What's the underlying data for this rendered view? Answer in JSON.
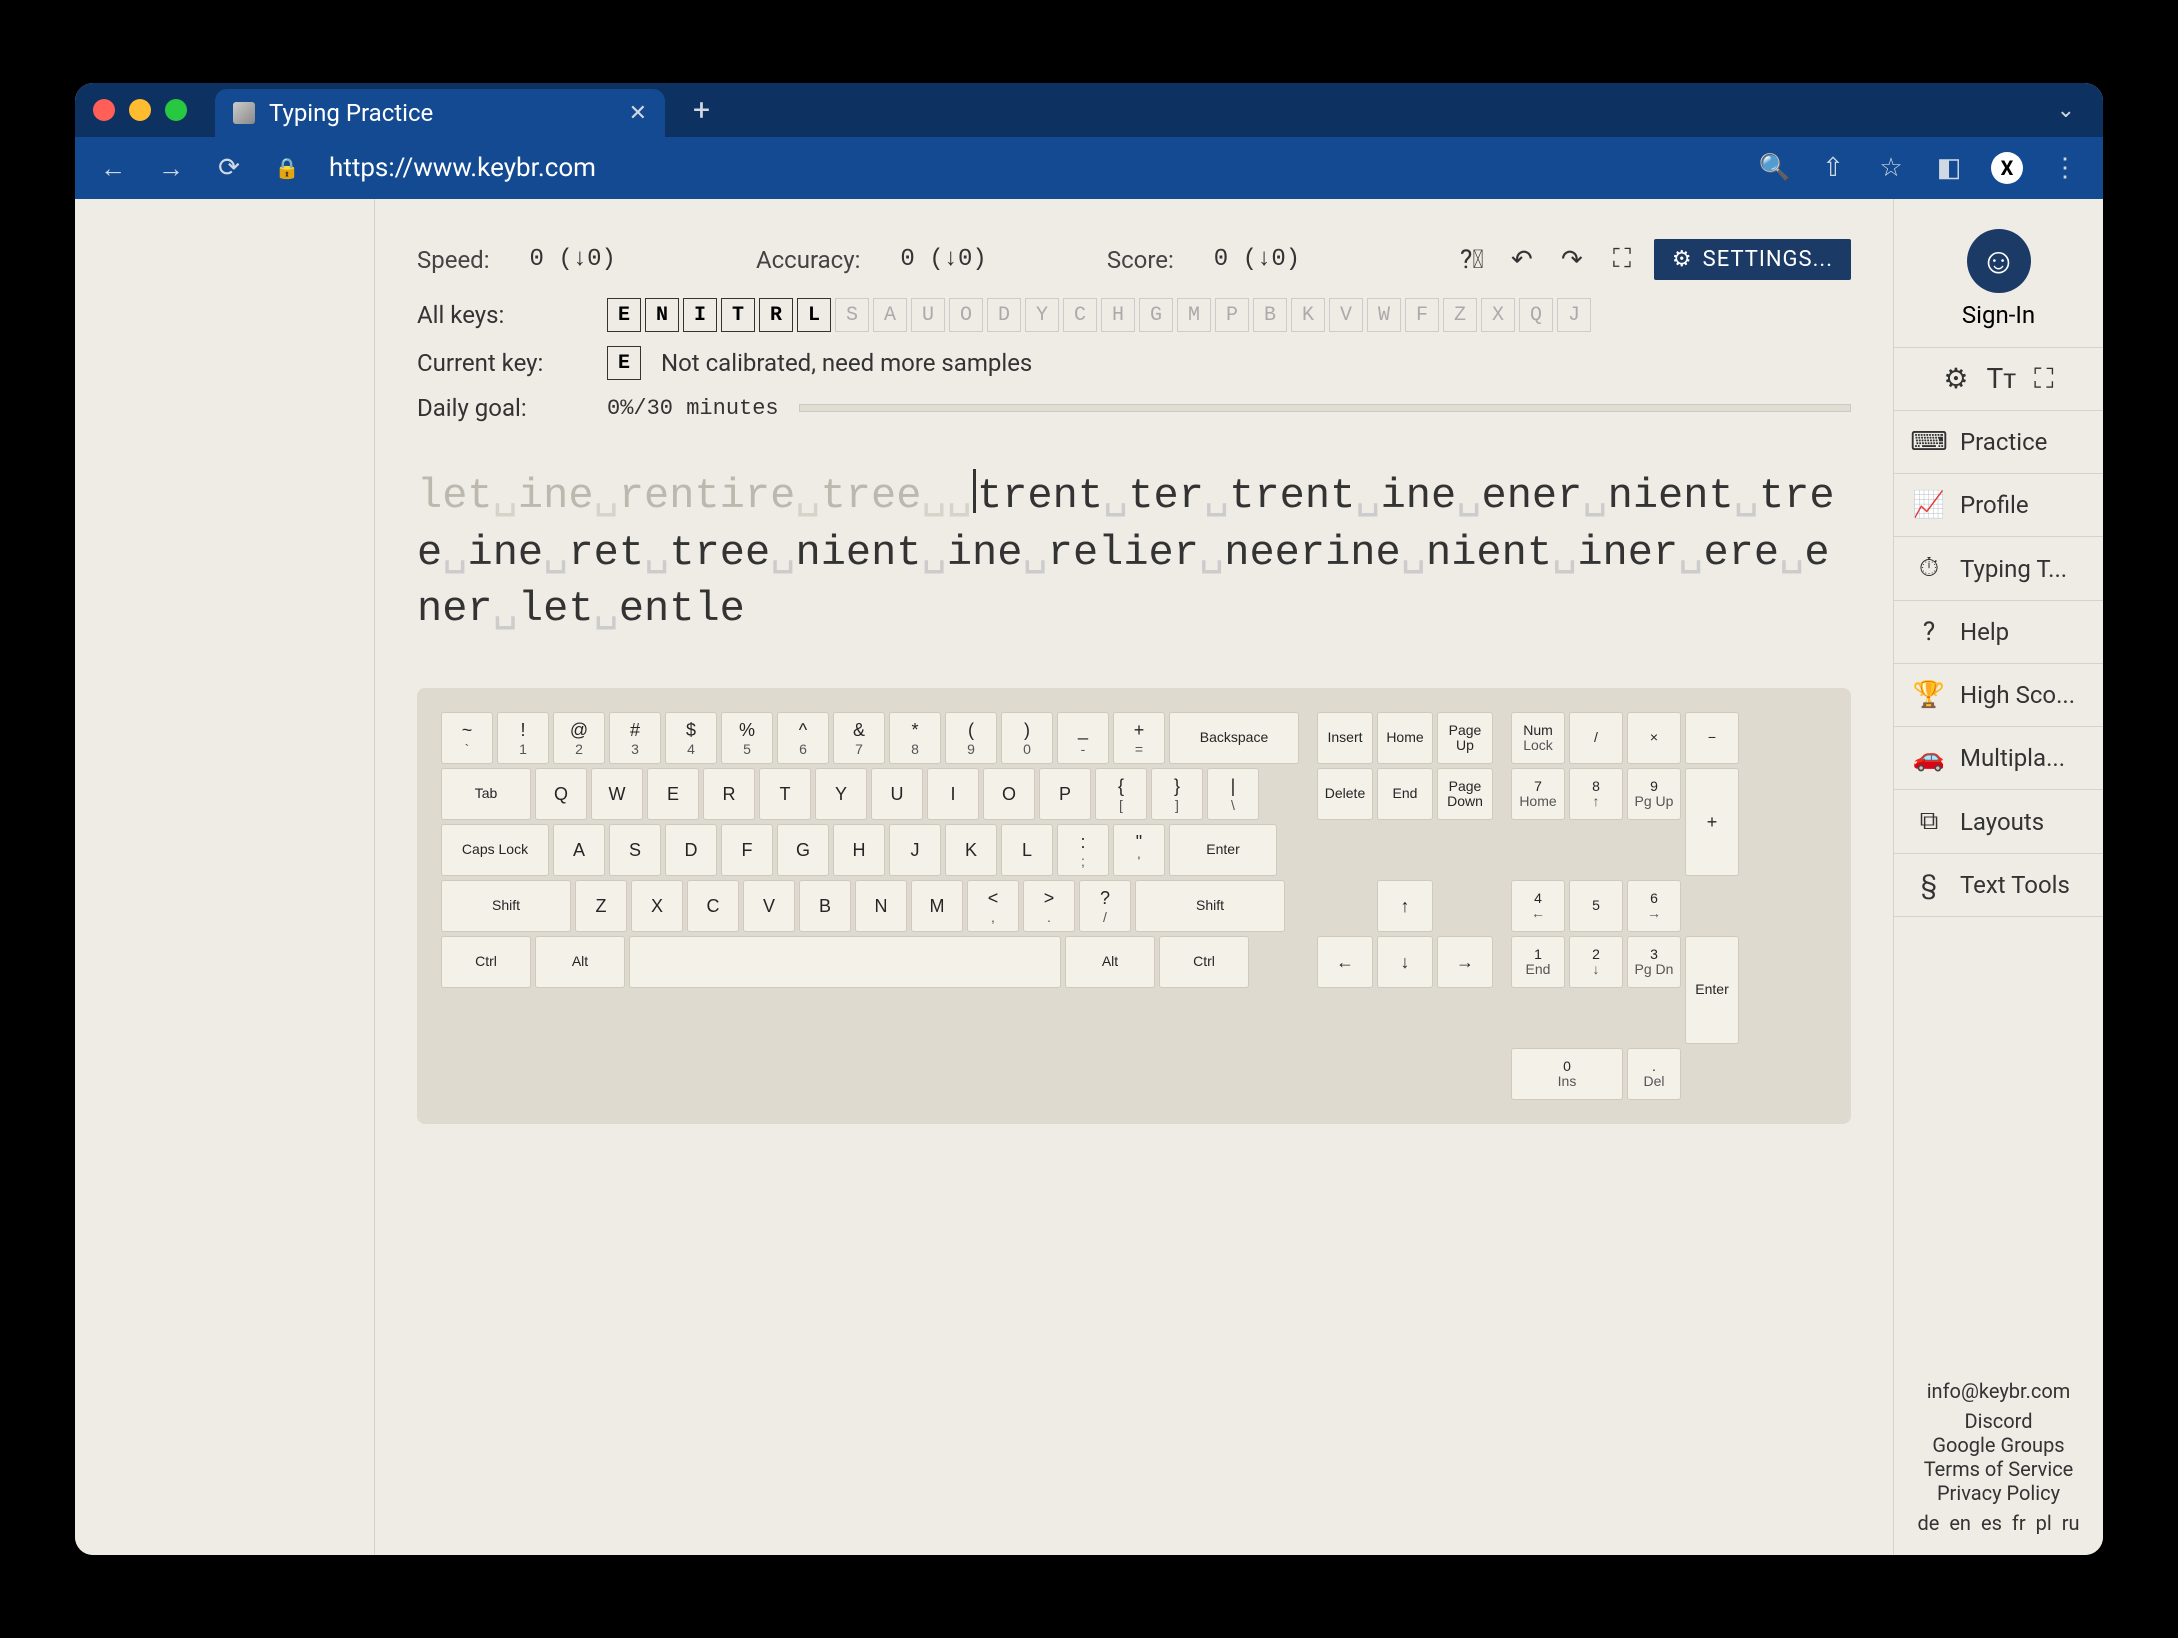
{
  "browser": {
    "tab_title": "Typing Practice",
    "url": "https://www.keybr.com",
    "avatar_letter": "X"
  },
  "stats": {
    "speed_label": "Speed:",
    "speed_value": "0 (↓0)",
    "accuracy_label": "Accuracy:",
    "accuracy_value": "0 (↓0)",
    "score_label": "Score:",
    "score_value": "0 (↓0)"
  },
  "settings_label": "SETTINGS...",
  "rows": {
    "all_keys_label": "All keys:",
    "keys_active": [
      "E",
      "N",
      "I",
      "T",
      "R",
      "L"
    ],
    "keys_inactive": [
      "S",
      "A",
      "U",
      "O",
      "D",
      "Y",
      "C",
      "H",
      "G",
      "M",
      "P",
      "B",
      "K",
      "V",
      "W",
      "F",
      "Z",
      "X",
      "Q",
      "J"
    ],
    "current_key_label": "Current key:",
    "current_key": "E",
    "current_msg": "Not calibrated, need more samples",
    "daily_goal_label": "Daily goal:",
    "daily_goal_value": "0%/30 minutes"
  },
  "typing": {
    "typed": "let ine rentire tree ",
    "remaining": "trent ter trent ine ener nient tree ine ret tree nient ine relier neerine nient iner ere ener let entle"
  },
  "keyboard": {
    "row1": [
      {
        "t": "~",
        "b": "`"
      },
      {
        "t": "!",
        "b": "1"
      },
      {
        "t": "@",
        "b": "2"
      },
      {
        "t": "#",
        "b": "3"
      },
      {
        "t": "$",
        "b": "4"
      },
      {
        "t": "%",
        "b": "5"
      },
      {
        "t": "^",
        "b": "6"
      },
      {
        "t": "&",
        "b": "7"
      },
      {
        "t": "*",
        "b": "8"
      },
      {
        "t": "(",
        "b": "9"
      },
      {
        "t": ")",
        "b": "0"
      },
      {
        "t": "_",
        "b": "-"
      },
      {
        "t": "+",
        "b": "="
      }
    ],
    "row1_end": "Backspace",
    "row2_start": "Tab",
    "row2": [
      "Q",
      "W",
      "E",
      "R",
      "T",
      "Y",
      "U",
      "I",
      "O",
      "P"
    ],
    "row2_sym": [
      {
        "t": "{",
        "b": "["
      },
      {
        "t": "}",
        "b": "]"
      },
      {
        "t": "|",
        "b": "\\"
      }
    ],
    "row3_start": "Caps Lock",
    "row3": [
      "A",
      "S",
      "D",
      "F",
      "G",
      "H",
      "J",
      "K",
      "L"
    ],
    "row3_sym": [
      {
        "t": ":",
        "b": ";"
      },
      {
        "t": "\"",
        "b": "'"
      }
    ],
    "row3_end": "Enter",
    "row4_start": "Shift",
    "row4": [
      "Z",
      "X",
      "C",
      "V",
      "B",
      "N",
      "M"
    ],
    "row4_sym": [
      {
        "t": "<",
        "b": ","
      },
      {
        "t": ">",
        "b": "."
      },
      {
        "t": "?",
        "b": "/"
      }
    ],
    "row4_end": "Shift",
    "row5": [
      "Ctrl",
      "Alt",
      "",
      "Alt",
      "Ctrl"
    ],
    "nav1": [
      "Insert",
      "Home",
      "Page Up"
    ],
    "nav2": [
      "Delete",
      "End",
      "Page Down"
    ],
    "arrows": {
      "up": "↑",
      "left": "←",
      "down": "↓",
      "right": "→"
    },
    "num_top": [
      {
        "t": "Num",
        "b": "Lock"
      },
      {
        "t": "/"
      },
      {
        "t": "×"
      },
      {
        "t": "−"
      }
    ],
    "num_r1": [
      {
        "t": "7",
        "b": "Home"
      },
      {
        "t": "8",
        "b": "↑"
      },
      {
        "t": "9",
        "b": "Pg Up"
      }
    ],
    "num_r2": [
      {
        "t": "4",
        "b": "←"
      },
      {
        "t": "5",
        "b": ""
      },
      {
        "t": "6",
        "b": "→"
      }
    ],
    "num_r3": [
      {
        "t": "1",
        "b": "End"
      },
      {
        "t": "2",
        "b": "↓"
      },
      {
        "t": "3",
        "b": "Pg Dn"
      }
    ],
    "num_r4": [
      {
        "t": "0",
        "b": "Ins"
      },
      {
        "t": ".",
        "b": "Del"
      }
    ],
    "num_plus": "+",
    "num_enter": "Enter"
  },
  "sidebar": {
    "signin": "Sign-In",
    "nav": [
      {
        "icon": "⌨",
        "label": "Practice"
      },
      {
        "icon": "📈",
        "label": "Profile"
      },
      {
        "icon": "⏱",
        "label": "Typing T..."
      },
      {
        "icon": "?",
        "label": "Help"
      },
      {
        "icon": "🏆",
        "label": "High Sco..."
      },
      {
        "icon": "🚗",
        "label": "Multipla..."
      },
      {
        "icon": "⧉",
        "label": "Layouts"
      },
      {
        "icon": "§",
        "label": "Text Tools"
      }
    ],
    "footer": {
      "email": "info@keybr.com",
      "links": [
        "Discord",
        "Google Groups",
        "Terms of Service",
        "Privacy Policy"
      ],
      "locales": [
        "de",
        "en",
        "es",
        "fr",
        "pl",
        "ru"
      ]
    }
  }
}
